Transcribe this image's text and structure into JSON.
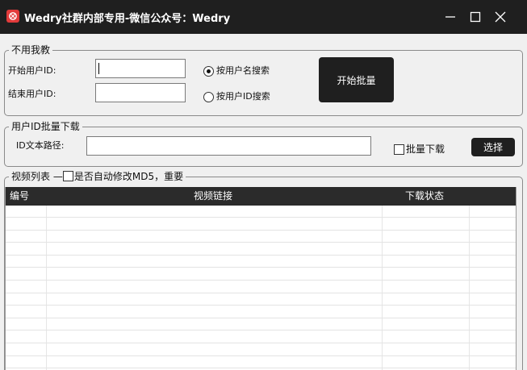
{
  "window": {
    "title": "Wedry社群内部专用-微信公众号：Wedry"
  },
  "group_range": {
    "title": "不用我教",
    "start_label": "开始用户ID:",
    "start_value": "",
    "end_label": "结束用户ID:",
    "end_value": "",
    "radio_username": "按用户名搜索",
    "radio_userid": "按用户ID搜索",
    "start_button": "开始批量"
  },
  "group_batch": {
    "title": "用户ID批量下载",
    "path_label": "ID文本路径:",
    "path_value": "",
    "batch_check_label": "批量下载",
    "select_button": "选择"
  },
  "group_videos": {
    "title": "视频列表",
    "md5_label": "是否自动修改MD5，重要",
    "columns": [
      "编号",
      "视频链接",
      "下载状态"
    ]
  }
}
